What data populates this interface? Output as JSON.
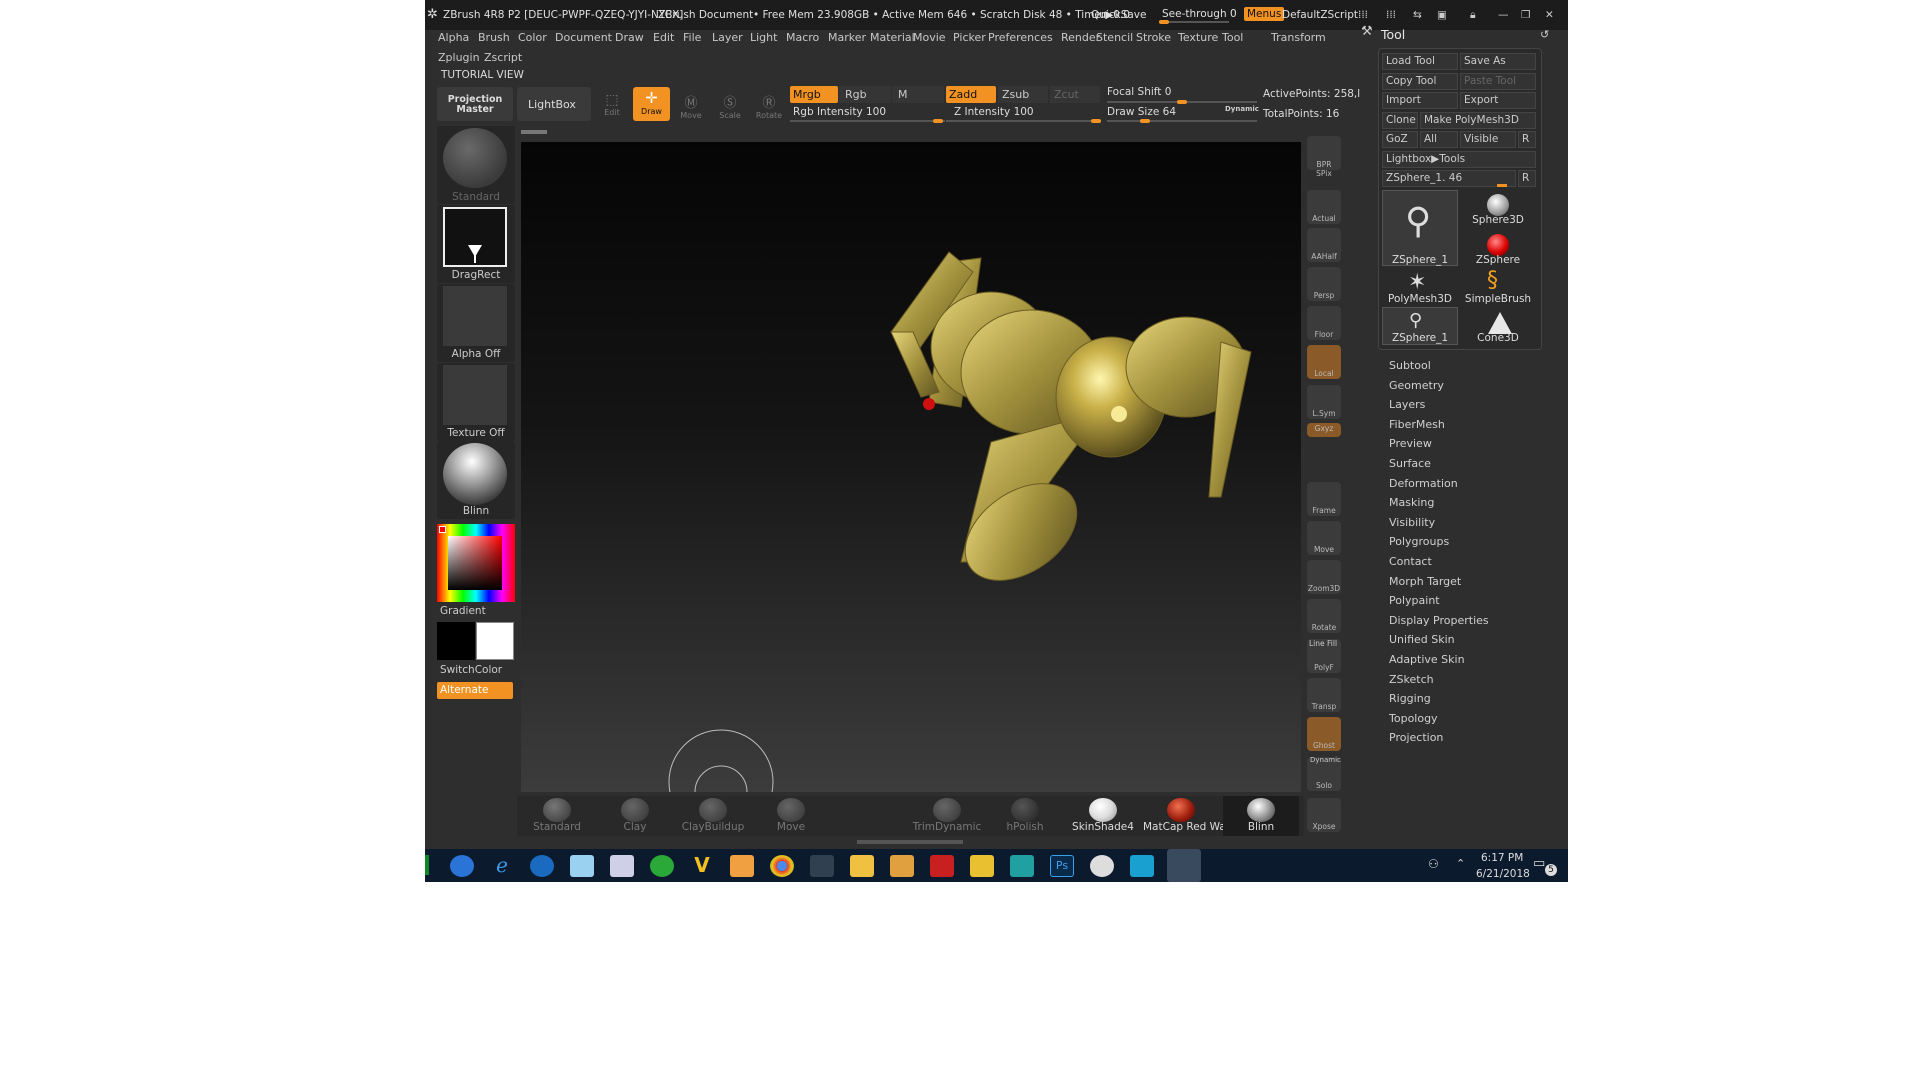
{
  "titlebar": {
    "app": "ZBrush 4R8 P2 [DEUC-PWPF-QZEQ-YJYI-NYCX]",
    "doc": "ZBrush Document",
    "mem": "• Free Mem 23.908GB • Active Mem 646 • Scratch Disk 48 • Timer▶0.0",
    "quicksave": "QuickSave",
    "seethrough": "See-through  0",
    "menus": "Menus",
    "script": "DefaultZScript"
  },
  "menu1": [
    "Alpha",
    "Brush",
    "Color",
    "Document",
    "Draw",
    "Edit",
    "File",
    "Layer",
    "Light",
    "Macro",
    "Marker",
    "Material",
    "Movie",
    "Picker",
    "Preferences",
    "Render",
    "Stencil",
    "Stroke",
    "Texture",
    "Tool",
    "Transform"
  ],
  "menu2": [
    "Zplugin",
    "Zscript"
  ],
  "tutorial": "TUTORIAL VIEW",
  "shelf": {
    "projection_master": "Projection Master",
    "lightbox": "LightBox",
    "edit": "Edit",
    "draw": "Draw",
    "move": "Move",
    "scale": "Scale",
    "rotate": "Rotate",
    "mrgb": "Mrgb",
    "rgb": "Rgb",
    "m": "M",
    "rgb_intensity": "Rgb Intensity 100",
    "zadd": "Zadd",
    "zsub": "Zsub",
    "zcut": "Zcut",
    "z_intensity": "Z Intensity 100",
    "focal_shift": "Focal Shift 0",
    "draw_size": "Draw Size 64",
    "dynamic": "Dynamic",
    "active_points": "ActivePoints: 258,l",
    "total_points": "TotalPoints: 16"
  },
  "leftpanel": {
    "brush": "Standard",
    "stroke": "DragRect",
    "alpha": "Alpha Off",
    "texture": "Texture Off",
    "material": "Blinn",
    "gradient": "Gradient",
    "switchcolor": "SwitchColor",
    "alternate": "Alternate"
  },
  "rightshelf": {
    "bpr": "BPR",
    "spix": "SPix",
    "actual": "Actual",
    "aahalf": "AAHalf",
    "persp": "Persp",
    "floor": "Floor",
    "local": "Local",
    "lsym": "L.Sym",
    "xyz": "Gxyz",
    "frame": "Frame",
    "move": "Move",
    "zoom3d": "Zoom3D",
    "rotate": "Rotate",
    "linefill": "Line Fill",
    "polyf": "PolyF",
    "transp": "Transp",
    "ghost": "Ghost",
    "dynamic": "Dynamic",
    "solo": "Solo",
    "xpose": "Xpose"
  },
  "bottombrushes": [
    "Standard",
    "Clay",
    "ClayBuildup",
    "Move",
    "TrimDynamic",
    "hPolish",
    "SkinShade4",
    "MatCap Red Wax",
    "Blinn"
  ],
  "toolpanel": {
    "title": "Tool",
    "load": "Load Tool",
    "saveas": "Save As",
    "copy": "Copy Tool",
    "paste": "Paste Tool",
    "import": "Import",
    "export": "Export",
    "clone": "Clone",
    "makepm": "Make PolyMesh3D",
    "goz": "GoZ",
    "all": "All",
    "visible": "Visible",
    "r": "R",
    "lightbox": "Lightbox▶Tools",
    "zsphere_slider": "ZSphere_1. 46",
    "r2": "R",
    "thumbs": [
      "ZSphere_1",
      "Sphere3D",
      "ZSphere",
      "PolyMesh3D",
      "SimpleBrush",
      "ZSphere_1",
      "Cone3D"
    ],
    "subpalettes": [
      "Subtool",
      "Geometry",
      "Layers",
      "FiberMesh",
      "Preview",
      "Surface",
      "Deformation",
      "Masking",
      "Visibility",
      "Polygroups",
      "Contact",
      "Morph Target",
      "Polypaint",
      "Display Properties",
      "Unified Skin",
      "Adaptive Skin",
      "ZSketch",
      "Rigging",
      "Topology",
      "Projection"
    ]
  },
  "taskbar": {
    "time": "6:17 PM",
    "date": "6/21/2018",
    "notif": "5"
  },
  "colors": {
    "accent": "#f29222",
    "bg": "#2e2e2e",
    "gold": "#c9b048"
  }
}
